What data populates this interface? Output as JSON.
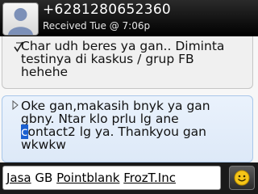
{
  "header": {
    "contact": "+6281280652360",
    "received": "Received Tue @ 7:06p",
    "avatar_icon": "contact-avatar-icon"
  },
  "messages": [
    {
      "type": "sent",
      "status_icon": "delivered-check-icon",
      "text": "Char udh beres ya gan.. Diminta\ntestinya di kaskus / grup FB\nhehehe"
    },
    {
      "type": "received",
      "icon": "received-arrow-icon",
      "text_before_cursor": "Oke gan,makasih bnyk ya gan\ngbny. Ntar klo prlu lg ane\n",
      "cursor_char": "c",
      "text_after_cursor": "ontact2 lg ya. Thankyou gan\nwkwkw"
    }
  ],
  "compose": {
    "words": [
      "Jasa",
      "GB",
      "Pointblank",
      "FrozT.Inc"
    ],
    "emoticon_icon": "smiley-icon"
  },
  "colors": {
    "header_bg": "#000000",
    "received_bubble": "#e4eefb",
    "selection": "#1a5fd0"
  }
}
